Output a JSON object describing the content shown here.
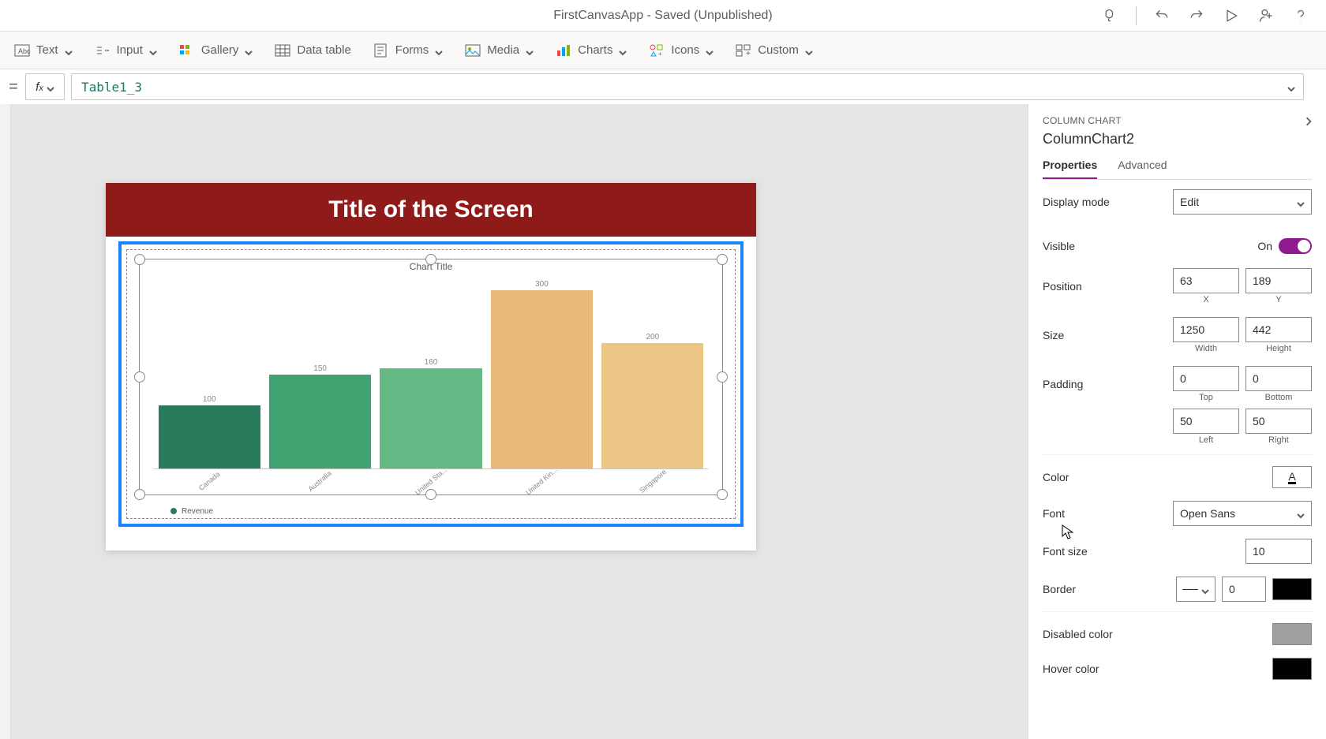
{
  "titlebar": {
    "title": "FirstCanvasApp - Saved (Unpublished)"
  },
  "ribbon": {
    "text": "Text",
    "input": "Input",
    "gallery": "Gallery",
    "datatable": "Data table",
    "forms": "Forms",
    "media": "Media",
    "charts": "Charts",
    "icons": "Icons",
    "custom": "Custom"
  },
  "formula": {
    "value": "Table1_3"
  },
  "canvas": {
    "screen_title": "Title of the Screen",
    "chart_title": "Chart Title",
    "legend": "Revenue"
  },
  "chart_data": {
    "type": "bar",
    "categories": [
      "Canada",
      "Australia",
      "United Sta...",
      "United Kin...",
      "Singapore"
    ],
    "values": [
      100,
      150,
      160,
      300,
      200
    ],
    "colors": [
      "#2a7b5c",
      "#3fa371",
      "#63b884",
      "#e9b97a",
      "#edc686"
    ],
    "title": "Chart Title",
    "legend": "Revenue",
    "ylim": [
      0,
      300
    ]
  },
  "props": {
    "type": "COLUMN CHART",
    "name": "ColumnChart2",
    "tab_properties": "Properties",
    "tab_advanced": "Advanced",
    "display_mode_label": "Display mode",
    "display_mode_value": "Edit",
    "visible_label": "Visible",
    "visible_value": "On",
    "position_label": "Position",
    "position_x": "63",
    "position_y": "189",
    "x_label": "X",
    "y_label": "Y",
    "size_label": "Size",
    "size_w": "1250",
    "size_h": "442",
    "w_label": "Width",
    "h_label": "Height",
    "padding_label": "Padding",
    "pad_top": "0",
    "pad_bottom": "0",
    "pad_left": "50",
    "pad_right": "50",
    "top_label": "Top",
    "bottom_label": "Bottom",
    "left_label": "Left",
    "right_label": "Right",
    "color_label": "Color",
    "font_label": "Font",
    "font_value": "Open Sans",
    "fontsize_label": "Font size",
    "fontsize_value": "10",
    "border_label": "Border",
    "border_width": "0",
    "disabled_color_label": "Disabled color",
    "hover_color_label": "Hover color"
  }
}
